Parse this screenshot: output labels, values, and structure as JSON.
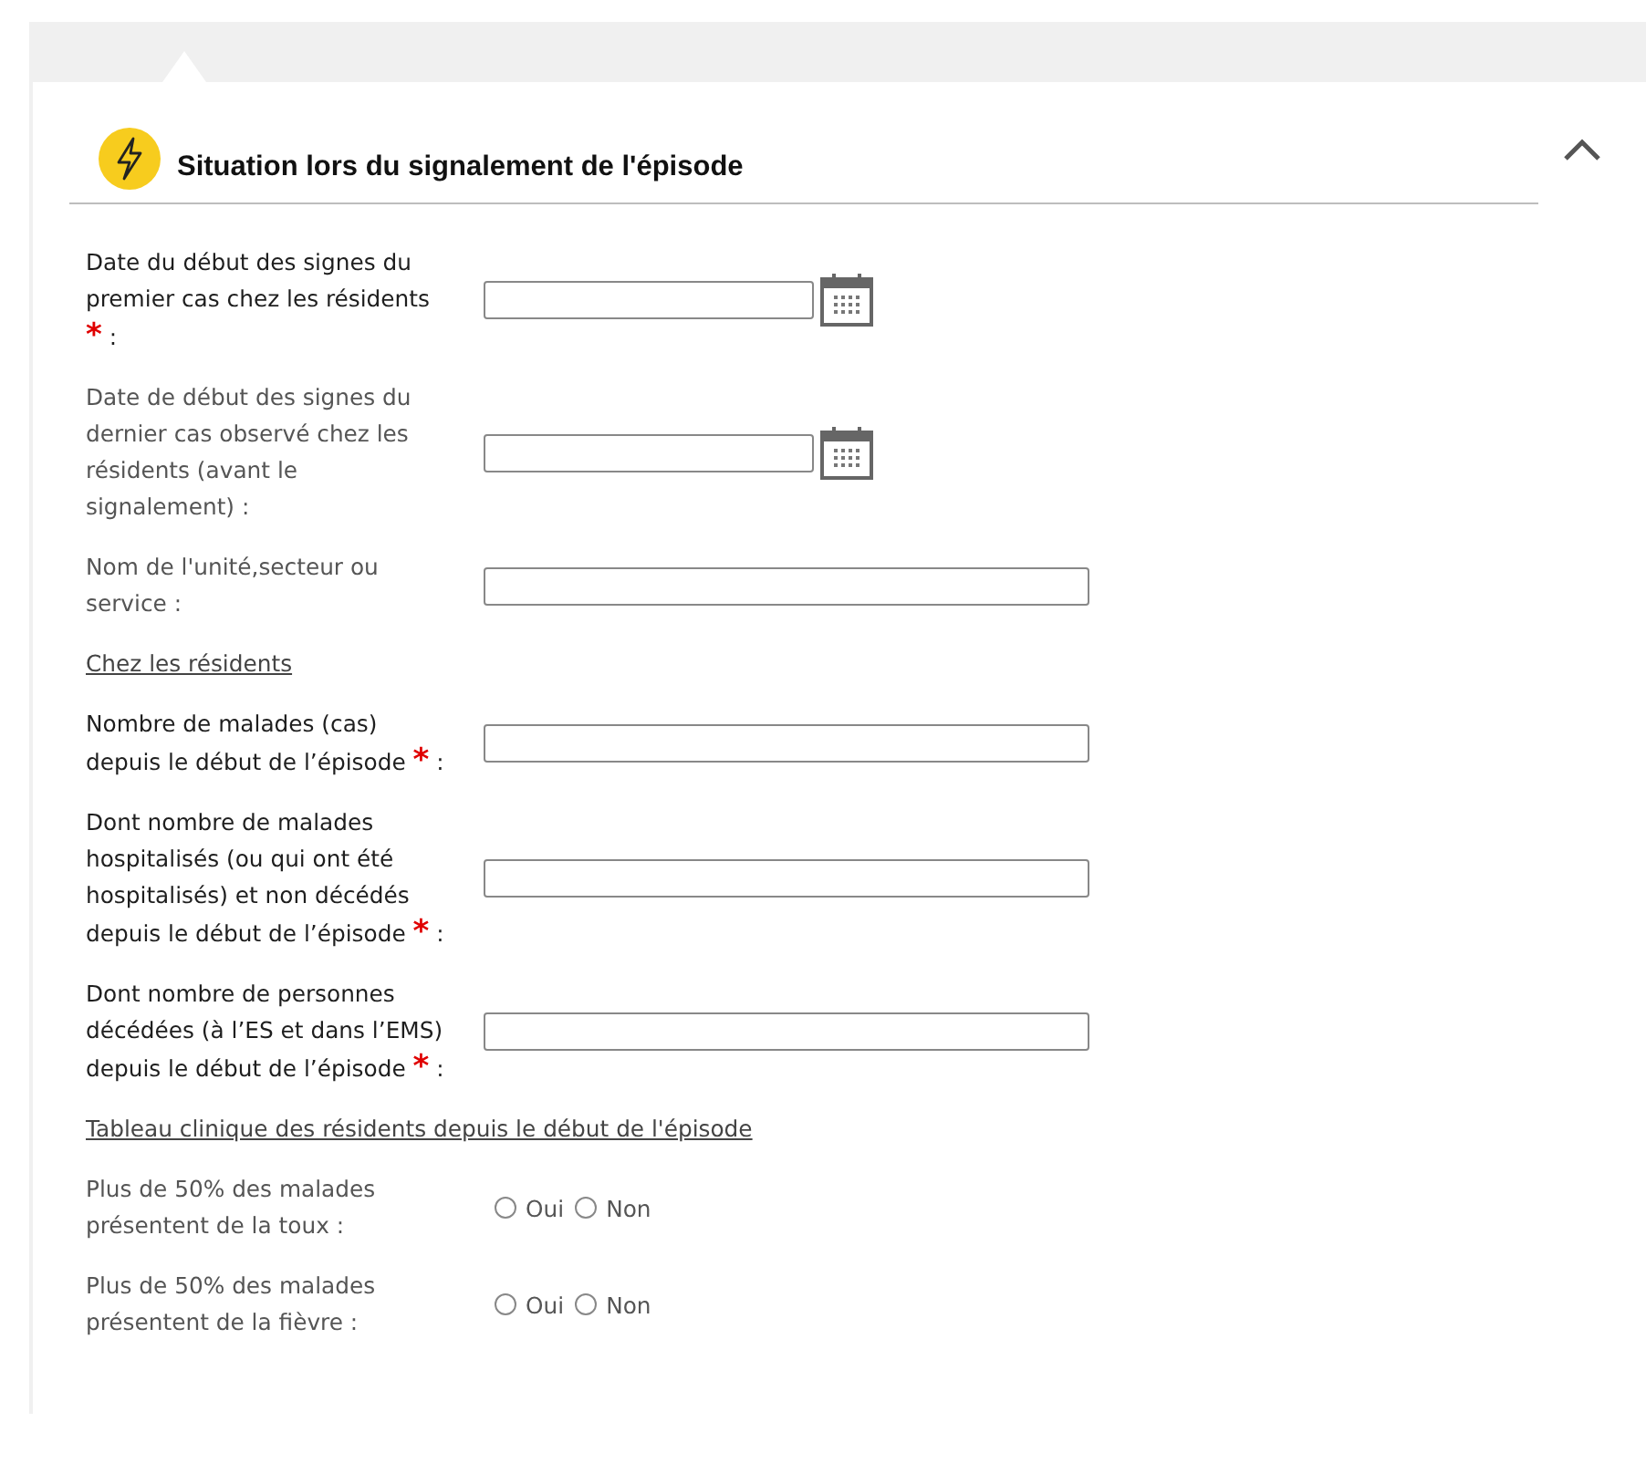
{
  "section": {
    "title": "Situation lors du signalement de l'épisode",
    "expanded": true
  },
  "rows": [
    {
      "kind": "date",
      "label": "Date du début des signes du premier cas chez les résidents",
      "required": true,
      "mark": "*",
      "colon": ":"
    },
    {
      "kind": "date",
      "label": "Date de début des signes du dernier cas observé chez les résidents (avant le signalement)",
      "required": false,
      "colon": ":"
    },
    {
      "kind": "text",
      "label": "Nom de l'unité,secteur ou service",
      "required": false,
      "colon": ":"
    },
    {
      "kind": "heading",
      "label": "Chez les résidents"
    },
    {
      "kind": "text",
      "label": "Nombre de malades (cas) depuis le début de l’épisode",
      "required": true,
      "mark": "*",
      "colon": ":"
    },
    {
      "kind": "text",
      "label": "Dont nombre de malades hospitalisés (ou qui ont été hospitalisés) et non décédés depuis le début de l’épisode",
      "required": true,
      "mark": "*",
      "colon": ":"
    },
    {
      "kind": "text",
      "label": "Dont nombre de personnes décédées (à l’ES et dans l’EMS) depuis le début de l’épisode",
      "required": true,
      "mark": "*",
      "colon": ":"
    },
    {
      "kind": "heading",
      "label": "Tableau clinique des résidents depuis le début de l'épisode"
    },
    {
      "kind": "radio",
      "label": "Plus de 50% des malades présentent de la toux",
      "required": false,
      "colon": ":",
      "options": [
        {
          "label": "Oui",
          "selected": false
        },
        {
          "label": "Non",
          "selected": false
        }
      ]
    },
    {
      "kind": "radio",
      "label": "Plus de 50% des malades présentent de la fièvre",
      "required": false,
      "colon": ":",
      "options": [
        {
          "label": "Oui",
          "selected": false
        },
        {
          "label": "Non",
          "selected": false
        }
      ]
    }
  ]
}
